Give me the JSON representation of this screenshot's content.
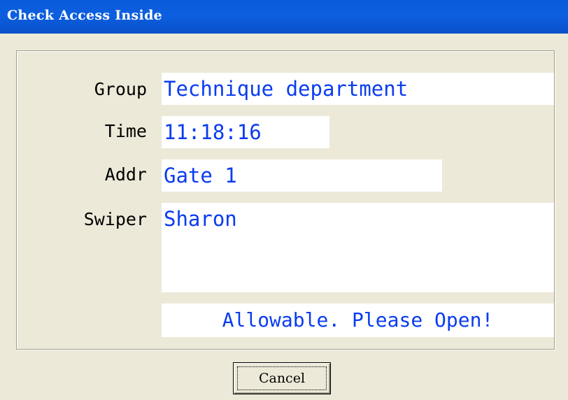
{
  "window": {
    "title": "Check Access Inside"
  },
  "form": {
    "group_label": "Group",
    "group_value": "Technique department",
    "time_label": "Time",
    "time_value": "11:18:16",
    "addr_label": "Addr",
    "addr_value": "Gate 1",
    "swiper_label": "Swiper",
    "swiper_value": "Sharon",
    "status_text": "Allowable. Please Open!"
  },
  "buttons": {
    "cancel_label": "Cancel"
  },
  "colors": {
    "titlebar": "#0a5ad8",
    "window_bg": "#ece9d8",
    "value_text": "#0a3cf0"
  }
}
